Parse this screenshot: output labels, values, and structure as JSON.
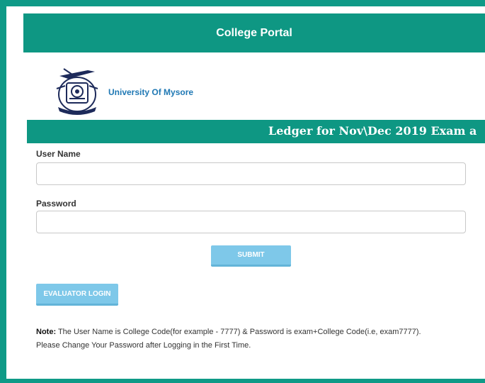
{
  "colors": {
    "brand_teal": "#0e9783",
    "button_blue": "#7ec8e9",
    "link_blue": "#1f78b4"
  },
  "header": {
    "title": "College Portal"
  },
  "university": {
    "logo_icon": "university-crest-icon",
    "name": "University Of Mysore"
  },
  "marquee": {
    "text": "Ledger for Nov\\Dec 2019 Exam a"
  },
  "form": {
    "username_label": "User Name",
    "username_value": "",
    "username_placeholder": "",
    "password_label": "Password",
    "password_value": "",
    "password_placeholder": "",
    "submit_label": "SUBMIT",
    "evaluator_label": "EVALUATOR LOGIN"
  },
  "note": {
    "prefix": "Note:",
    "line1": " The User Name is College Code(for example - 7777) & Password is exam+College Code(i.e, exam7777).",
    "line2": "Please Change Your Password after Logging in the First Time."
  }
}
